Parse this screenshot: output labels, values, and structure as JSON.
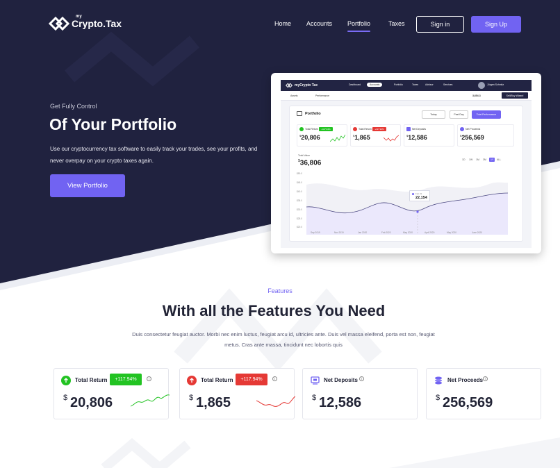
{
  "brand": {
    "my": "my",
    "name": "Crypto.Tax"
  },
  "nav": {
    "links": [
      "Home",
      "Accounts",
      "Portfolio",
      "Taxes"
    ],
    "active": "Portfolio",
    "signin": "Sign in",
    "signup": "Sign Up"
  },
  "hero": {
    "kicker": "Get Fully Control",
    "title": "Of Your Portfolio",
    "description": "Use our cryptocurrency tax software to easily track your trades, see your profits, and never overpay on your crypto taxes again.",
    "cta": "View Portfolio"
  },
  "mock": {
    "logo": "myCrypto Tax",
    "nav": [
      "Dashboard",
      "Accounts",
      "Portfolio",
      "Taxes",
      "Advisor",
      "Services"
    ],
    "user": "Jürgen Schmitz",
    "sub": [
      "Assets",
      "Performance"
    ],
    "sub_value": "3,654.3",
    "sub_button": "Sell/Buy Wizard",
    "panel_title": "Portfolio",
    "dropdowns": [
      "Today",
      "Past Day",
      "Total Performance"
    ],
    "cards": [
      {
        "label": "Total Return",
        "badge": "+117.94%",
        "value": "20,806"
      },
      {
        "label": "Total Return",
        "badge": "+117.94%",
        "value": "1,865"
      },
      {
        "label": "Net Deposits",
        "value": "12,586"
      },
      {
        "label": "Net Proceeds",
        "value": "256,569"
      }
    ],
    "total_value_label": "Total Value",
    "total_value": "36,806",
    "ranges": [
      "1D",
      "1W",
      "1M",
      "3M",
      "1Y",
      "ALL"
    ],
    "active_range": "1Y",
    "y_ticks": [
      "$50.0",
      "$45.0",
      "$40.0",
      "$35.0",
      "$30.0",
      "$25.0",
      "$20.0",
      "$15.0"
    ],
    "x_ticks": [
      "Sep 2019",
      "Nov 2019",
      "Jan 2020",
      "Feb 2020",
      "May 2020",
      "April 2020",
      "May 2020",
      "June 2020"
    ],
    "tooltip_label": "Feb 22",
    "tooltip_value": "22,154"
  },
  "features": {
    "kicker": "Features",
    "title": "With all the Features You Need",
    "description": "Duis consectetur feugiat auctor. Morbi nec enim luctus, feugiat arcu id, ultricies ante. Duis vel massa eleifend, porta est non, feugiat metus. Cras ante massa, tincidunt nec lobortis quis",
    "cards": [
      {
        "label": "Total Return",
        "badge": "+117.94%",
        "currency": "$",
        "value": "20,806",
        "trend": "up",
        "icon": "arrow-up-icon"
      },
      {
        "label": "Total Return",
        "badge": "+117.94%",
        "currency": "$",
        "value": "1,865",
        "trend": "down",
        "icon": "arrow-up-icon"
      },
      {
        "label": "Net Deposits",
        "currency": "$",
        "value": "12,586",
        "icon": "deposit-icon"
      },
      {
        "label": "Net Proceeds",
        "currency": "$",
        "value": "256,569",
        "icon": "coins-icon"
      }
    ]
  },
  "colors": {
    "navy": "#20223f",
    "accent": "#7163f2",
    "green": "#22c322",
    "red": "#e53935"
  }
}
